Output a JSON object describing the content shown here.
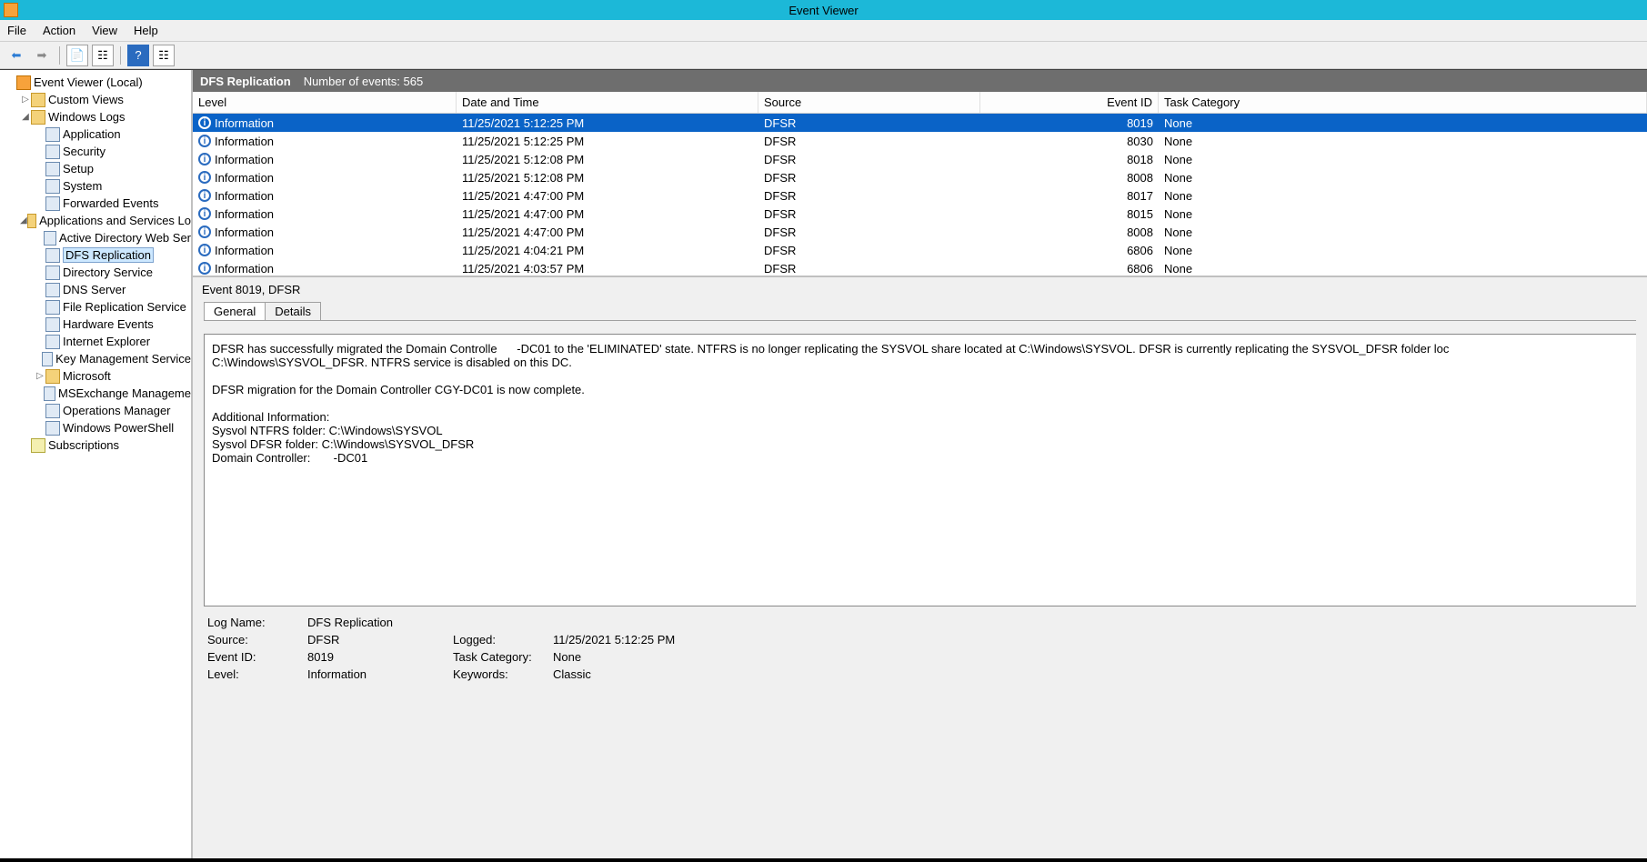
{
  "window": {
    "title": "Event Viewer"
  },
  "menu": {
    "file": "File",
    "action": "Action",
    "view": "View",
    "help": "Help"
  },
  "tree": {
    "root": "Event Viewer (Local)",
    "custom_views": "Custom Views",
    "windows_logs": "Windows Logs",
    "wl": {
      "application": "Application",
      "security": "Security",
      "setup": "Setup",
      "system": "System",
      "forwarded": "Forwarded Events"
    },
    "app_services": "Applications and Services Lo",
    "as": {
      "adws": "Active Directory Web Ser",
      "dfs": "DFS Replication",
      "ds": "Directory Service",
      "dns": "DNS Server",
      "frs": "File Replication Service",
      "hw": "Hardware Events",
      "ie": "Internet Explorer",
      "kms": "Key Management Service",
      "ms": "Microsoft",
      "msx": "MSExchange Manageme",
      "om": "Operations Manager",
      "ps": "Windows PowerShell"
    },
    "subscriptions": "Subscriptions"
  },
  "header": {
    "title": "DFS Replication",
    "count_label": "Number of events: 565"
  },
  "columns": {
    "level": "Level",
    "date": "Date and Time",
    "source": "Source",
    "eventid": "Event ID",
    "taskcat": "Task Category"
  },
  "events": [
    {
      "level": "Information",
      "date": "11/25/2021 5:12:25 PM",
      "source": "DFSR",
      "id": "8019",
      "task": "None"
    },
    {
      "level": "Information",
      "date": "11/25/2021 5:12:25 PM",
      "source": "DFSR",
      "id": "8030",
      "task": "None"
    },
    {
      "level": "Information",
      "date": "11/25/2021 5:12:08 PM",
      "source": "DFSR",
      "id": "8018",
      "task": "None"
    },
    {
      "level": "Information",
      "date": "11/25/2021 5:12:08 PM",
      "source": "DFSR",
      "id": "8008",
      "task": "None"
    },
    {
      "level": "Information",
      "date": "11/25/2021 4:47:00 PM",
      "source": "DFSR",
      "id": "8017",
      "task": "None"
    },
    {
      "level": "Information",
      "date": "11/25/2021 4:47:00 PM",
      "source": "DFSR",
      "id": "8015",
      "task": "None"
    },
    {
      "level": "Information",
      "date": "11/25/2021 4:47:00 PM",
      "source": "DFSR",
      "id": "8008",
      "task": "None"
    },
    {
      "level": "Information",
      "date": "11/25/2021 4:04:21 PM",
      "source": "DFSR",
      "id": "6806",
      "task": "None"
    },
    {
      "level": "Information",
      "date": "11/25/2021 4:03:57 PM",
      "source": "DFSR",
      "id": "6806",
      "task": "None"
    }
  ],
  "detail": {
    "title": "Event 8019, DFSR",
    "tabs": {
      "general": "General",
      "details": "Details"
    },
    "description": "DFSR has successfully migrated the Domain Controlle      -DC01 to the 'ELIMINATED' state. NTFRS is no longer replicating the SYSVOL share located at C:\\Windows\\SYSVOL. DFSR is currently replicating the SYSVOL_DFSR folder loc\nC:\\Windows\\SYSVOL_DFSR. NTFRS service is disabled on this DC.\n\nDFSR migration for the Domain Controller CGY-DC01 is now complete.\n\nAdditional Information:\nSysvol NTFRS folder: C:\\Windows\\SYSVOL\nSysvol DFSR folder: C:\\Windows\\SYSVOL_DFSR\nDomain Controller:       -DC01",
    "props": {
      "logname_l": "Log Name:",
      "logname_v": "DFS Replication",
      "source_l": "Source:",
      "source_v": "DFSR",
      "logged_l": "Logged:",
      "logged_v": "11/25/2021 5:12:25 PM",
      "eventid_l": "Event ID:",
      "eventid_v": "8019",
      "taskcat_l": "Task Category:",
      "taskcat_v": "None",
      "level_l": "Level:",
      "level_v": "Information",
      "keywords_l": "Keywords:",
      "keywords_v": "Classic"
    }
  }
}
